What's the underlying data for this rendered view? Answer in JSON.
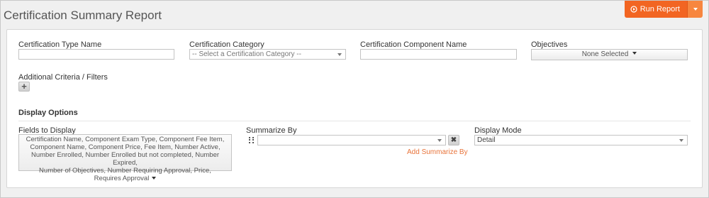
{
  "page": {
    "title": "Certification Summary Report"
  },
  "toolbar": {
    "run_label": "Run Report"
  },
  "filters": {
    "type_name_label": "Certification Type Name",
    "type_name_value": "",
    "category_label": "Certification Category",
    "category_value": "-- Select a Certification Category --",
    "component_name_label": "Certification Component Name",
    "component_name_value": "",
    "objectives_label": "Objectives",
    "objectives_value": "None Selected",
    "additional_label": "Additional Criteria / Filters"
  },
  "display_options": {
    "title": "Display Options",
    "fields_label": "Fields to Display",
    "fields_lines": [
      "Certification Name,  Component Exam Type,  Component Fee Item,",
      "Component Name,  Component Price,  Fee Item,  Number Active,",
      "Number Enrolled,  Number Enrolled but not completed,  Number Expired,",
      "Number of Objectives,  Number Requiring Approval,  Price,",
      "Requires Approval"
    ],
    "summarize_label": "Summarize By",
    "summarize_value": "",
    "add_summarize_label": "Add Summarize By",
    "mode_label": "Display Mode",
    "mode_value": "Detail"
  },
  "colors": {
    "accent": "#f26522",
    "link": "#e8743b"
  },
  "icons": [
    "play-circle-icon",
    "caret-down-icon",
    "plus-icon",
    "drag-handle-icon",
    "close-icon"
  ]
}
